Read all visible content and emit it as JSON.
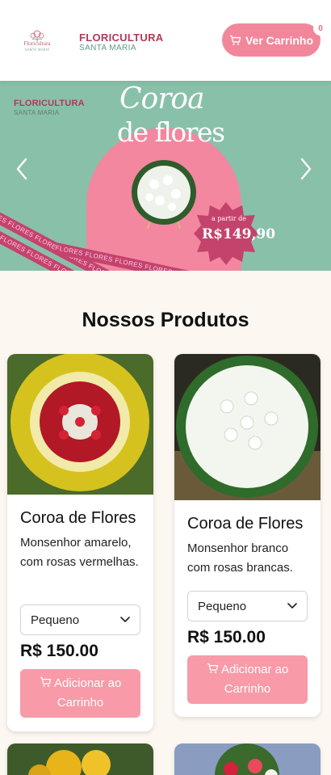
{
  "header": {
    "logo_text": "Floricultura",
    "logo_subtext": "SANTA MARIA",
    "brand_name": "FLORICULTURA",
    "brand_sub": "SANTA MARIA",
    "cart_button_label": "Ver Carrinho",
    "cart_count": "0"
  },
  "hero": {
    "brand_name": "FLORICULTURA",
    "brand_sub": "SANTA MARIA",
    "title_line1": "Coroa",
    "title_line2": "de flores",
    "price_prefix": "a partir de",
    "price_value": "R$149,90",
    "ribbon_text": "FLORES FLORES FLORES FLORES FLORES FLORES FLORES FLORES"
  },
  "products_section": {
    "title": "Nossos Produtos"
  },
  "products": [
    {
      "name": "Coroa de Flores",
      "description": "Monsenhor amarelo, com rosas vermelhas.",
      "size_option": "Pequeno",
      "price": "R$ 150.00",
      "add_button_label": "Adicionar ao Carrinho"
    },
    {
      "name": "Coroa de Flores",
      "description": "Monsenhor branco com rosas brancas.",
      "size_option": "Pequeno",
      "price": "R$ 150.00",
      "add_button_label": "Adicionar ao Carrinho"
    }
  ],
  "colors": {
    "accent_pink": "#f2879b",
    "button_pink": "#f89aa8",
    "brand_red": "#b23a57",
    "hero_green": "#89c0aa",
    "page_bg": "#fdf7f2"
  }
}
